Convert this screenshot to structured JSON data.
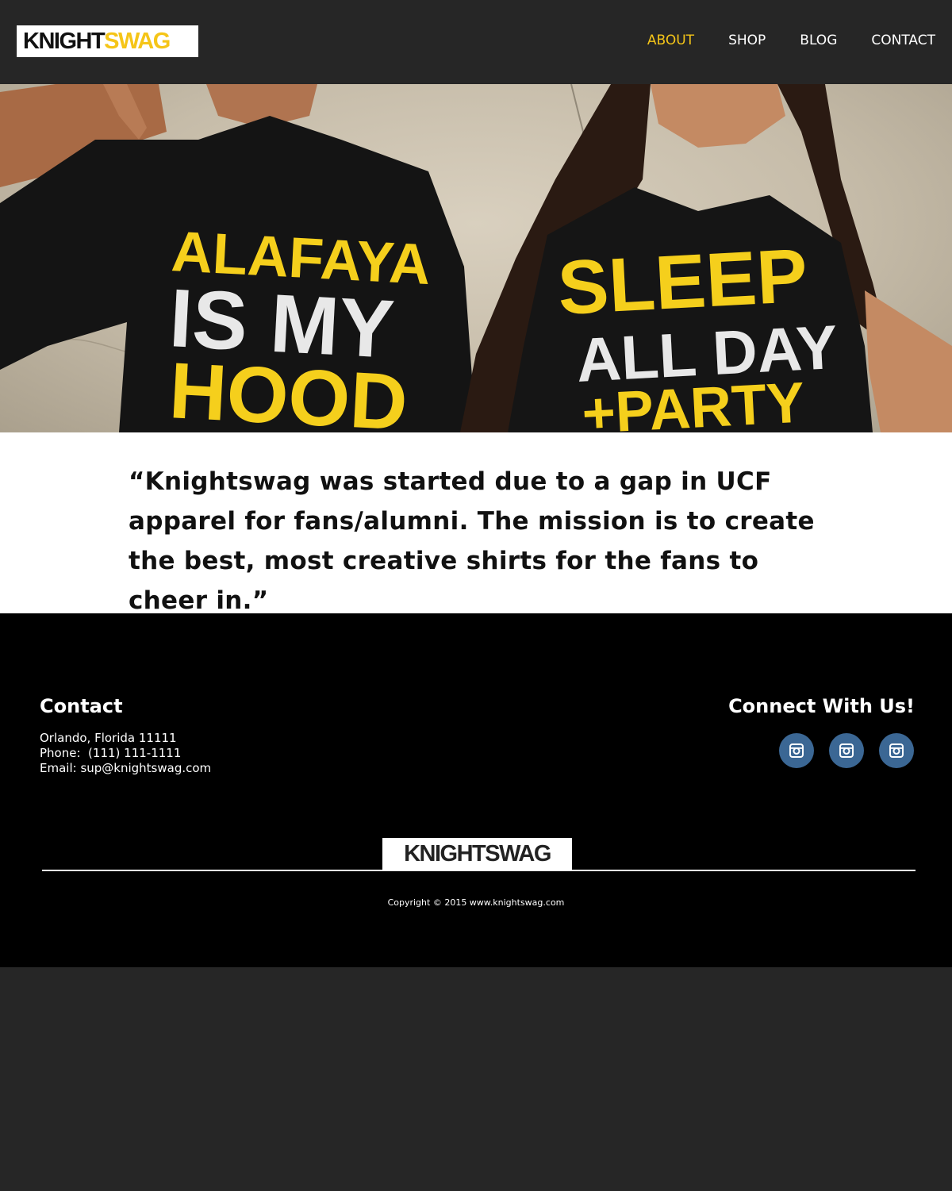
{
  "header": {
    "logo": {
      "part1": "KNIGHT",
      "part2": "SWAG"
    },
    "nav": [
      {
        "label": "ABOUT",
        "active": true
      },
      {
        "label": "SHOP",
        "active": false
      },
      {
        "label": "BLOG",
        "active": false
      },
      {
        "label": "CONTACT",
        "active": false
      }
    ]
  },
  "hero": {
    "shirt_left": [
      "ALAFAYA",
      "IS MY",
      "HOOD"
    ],
    "shirt_right": [
      "SLEEP",
      "ALL DAY",
      "+PARTY"
    ]
  },
  "quote": "“Knightswag was started due to a gap in UCF apparel for fans/alumni. The mission is to create the best, most creative shirts for the fans to cheer in.”",
  "footer": {
    "contact_title": "Contact",
    "address": "Orlando, Florida 11111",
    "phone": "Phone:  (111) 111-1111",
    "email": "Email: sup@knightswag.com",
    "connect_title": "Connect With Us!",
    "socials": [
      "instagram-icon",
      "instagram-icon",
      "instagram-icon"
    ],
    "logo": "KNIGHTSWAG",
    "copyright": "Copyright © 2015 www.knightswag.com"
  },
  "colors": {
    "accent": "#f5c518",
    "social": "#3b6794",
    "header_bg": "#262626"
  }
}
